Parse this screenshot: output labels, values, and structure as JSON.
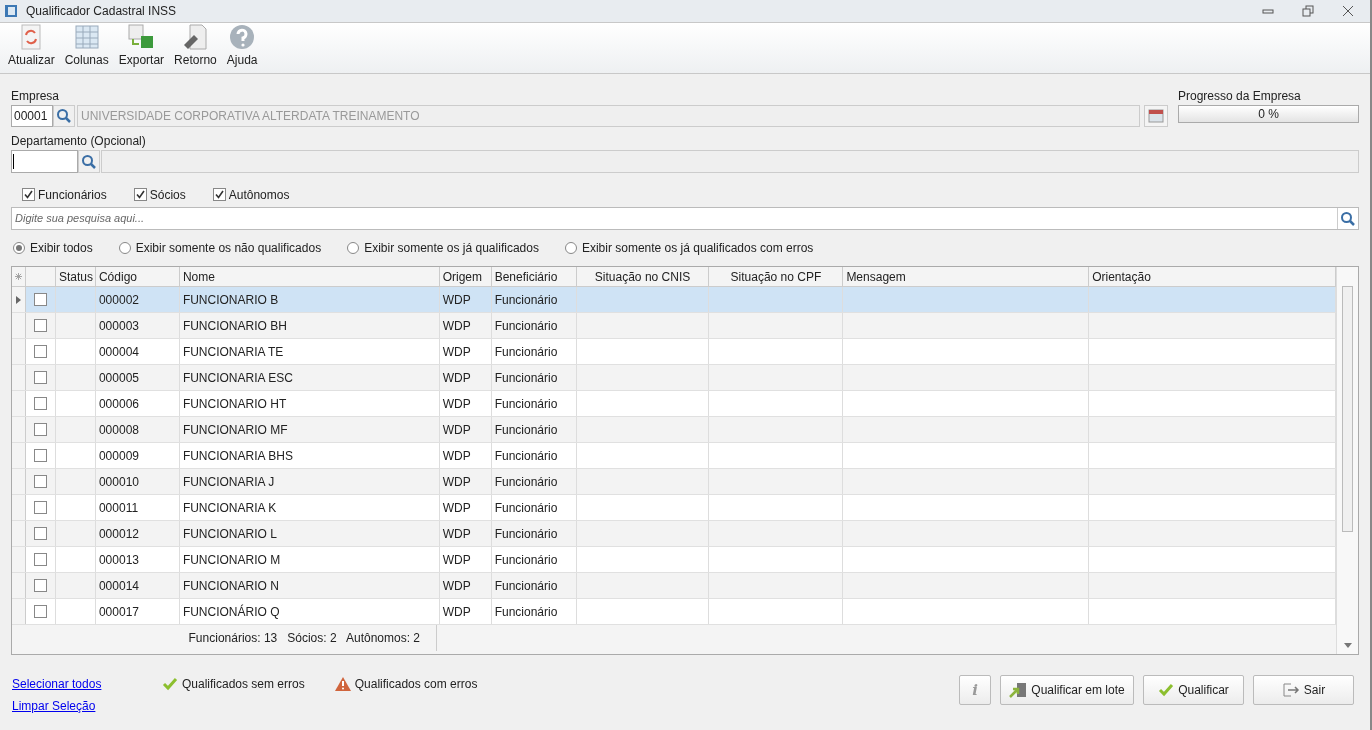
{
  "window": {
    "title": "Qualificador Cadastral INSS"
  },
  "toolbar": [
    {
      "kind": "refresh",
      "label": "Atualizar"
    },
    {
      "kind": "columns",
      "label": "Colunas"
    },
    {
      "kind": "export",
      "label": "Exportar"
    },
    {
      "kind": "return",
      "label": "Retorno"
    },
    {
      "kind": "help",
      "label": "Ajuda"
    }
  ],
  "empresa": {
    "label": "Empresa",
    "code": "00001",
    "name": "UNIVERSIDADE CORPORATIVA ALTERDATA TREINAMENTO"
  },
  "progress": {
    "label": "Progresso da Empresa",
    "level": 0,
    "reading": "0 %"
  },
  "departamento": {
    "label": "Departamento (Opcional)"
  },
  "filters": [
    {
      "label": "Funcionários",
      "checked": true
    },
    {
      "label": "Sócios",
      "checked": true
    },
    {
      "label": "Autônomos",
      "checked": true
    }
  ],
  "search": {
    "placeholder": "Digite sua pesquisa aqui..."
  },
  "views": [
    {
      "label": "Exibir todos",
      "selected": true
    },
    {
      "label": "Exibir somente os não qualificados",
      "selected": false
    },
    {
      "label": "Exibir somente os já qualificados",
      "selected": false
    },
    {
      "label": "Exibir somente os já qualificados com erros",
      "selected": false
    }
  ],
  "table": {
    "columns": [
      "Status",
      "Código",
      "Nome",
      "Origem",
      "Beneficiário",
      "Situação no CNIS",
      "Situação no CPF",
      "Mensagem",
      "Orientação"
    ],
    "rows": [
      {
        "selected": true,
        "checked": false,
        "codigo": "000002",
        "nome": "FUNCIONARIO B",
        "origem": "WDP",
        "beneficiario": "Funcionário"
      },
      {
        "selected": false,
        "checked": false,
        "codigo": "000003",
        "nome": "FUNCIONARIO BH",
        "origem": "WDP",
        "beneficiario": "Funcionário"
      },
      {
        "selected": false,
        "checked": false,
        "codigo": "000004",
        "nome": "FUNCIONARIA TE",
        "origem": "WDP",
        "beneficiario": "Funcionário"
      },
      {
        "selected": false,
        "checked": false,
        "codigo": "000005",
        "nome": "FUNCIONARIA ESC",
        "origem": "WDP",
        "beneficiario": "Funcionário"
      },
      {
        "selected": false,
        "checked": false,
        "codigo": "000006",
        "nome": "FUNCIONARIO HT",
        "origem": "WDP",
        "beneficiario": "Funcionário"
      },
      {
        "selected": false,
        "checked": false,
        "codigo": "000008",
        "nome": "FUNCIONARIO MF",
        "origem": "WDP",
        "beneficiario": "Funcionário"
      },
      {
        "selected": false,
        "checked": false,
        "codigo": "000009",
        "nome": "FUNCIONARIA BHS",
        "origem": "WDP",
        "beneficiario": "Funcionário"
      },
      {
        "selected": false,
        "checked": false,
        "codigo": "000010",
        "nome": "FUNCIONARIA J",
        "origem": "WDP",
        "beneficiario": "Funcionário"
      },
      {
        "selected": false,
        "checked": false,
        "codigo": "000011",
        "nome": "FUNCIONARIA K",
        "origem": "WDP",
        "beneficiario": "Funcionário"
      },
      {
        "selected": false,
        "checked": false,
        "codigo": "000012",
        "nome": "FUNCIONARIO L",
        "origem": "WDP",
        "beneficiario": "Funcionário"
      },
      {
        "selected": false,
        "checked": false,
        "codigo": "000013",
        "nome": "FUNCIONARIO M",
        "origem": "WDP",
        "beneficiario": "Funcionário"
      },
      {
        "selected": false,
        "checked": false,
        "codigo": "000014",
        "nome": "FUNCIONARIO N",
        "origem": "WDP",
        "beneficiario": "Funcionário"
      },
      {
        "selected": false,
        "checked": false,
        "codigo": "000017",
        "nome": "FUNCIONÁRIO Q",
        "origem": "WDP",
        "beneficiario": "Funcionário"
      }
    ],
    "summary": "Funcionários: 13   Sócios: 2   Autônomos: 2"
  },
  "links": [
    "Selecionar todos",
    "Limpar Seleção"
  ],
  "legend": [
    {
      "kind": "ok",
      "label": "Qualificados sem erros"
    },
    {
      "kind": "error",
      "label": "Qualificados com erros"
    }
  ],
  "buttons": [
    {
      "kind": "info",
      "label": "i"
    },
    {
      "kind": "batch",
      "label": "Qualificar em lote"
    },
    {
      "kind": "qualify",
      "label": "Qualificar"
    },
    {
      "kind": "exit",
      "label": "Sair"
    }
  ]
}
